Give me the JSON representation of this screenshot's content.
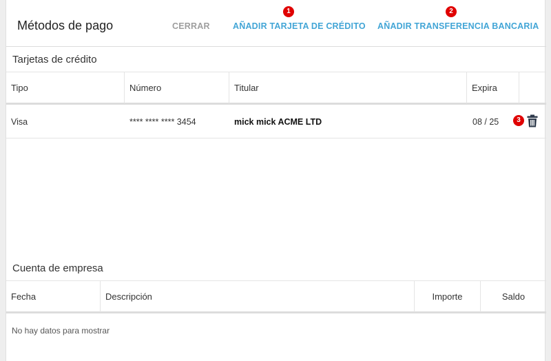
{
  "header": {
    "title": "Métodos de pago",
    "close_label": "CERRAR",
    "add_card_label": "AÑADIR TARJETA DE CRÉDITO",
    "add_transfer_label": "AÑADIR TRANSFERENCIA BANCARIA",
    "markers": [
      "1",
      "2",
      "3"
    ]
  },
  "cards": {
    "title": "Tarjetas de crédito",
    "columns": [
      "Tipo",
      "Número",
      "Titular",
      "Expira"
    ],
    "rows": [
      {
        "tipo": "Visa",
        "numero": "**** **** **** 3454",
        "titular": "mick mick ACME LTD",
        "expira": "08 / 25"
      }
    ]
  },
  "company": {
    "title": "Cuenta de empresa",
    "columns": [
      "Fecha",
      "Descripción",
      "Importe",
      "Saldo"
    ],
    "empty_text": "No hay datos para mostrar"
  },
  "colors": {
    "accent": "#42a5d6",
    "muted": "#9e9e9e",
    "marker": "#e00000",
    "icon": "#2f3b4c"
  },
  "icons": {
    "delete": "trash-icon"
  }
}
